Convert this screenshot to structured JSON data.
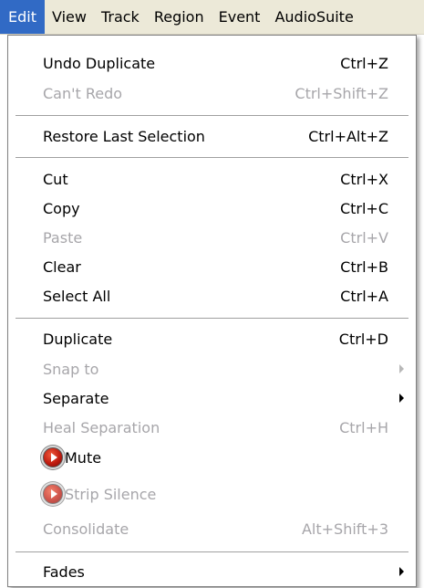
{
  "menubar": {
    "items": [
      {
        "label": "Edit"
      },
      {
        "label": "View"
      },
      {
        "label": "Track"
      },
      {
        "label": "Region"
      },
      {
        "label": "Event"
      },
      {
        "label": "AudioSuite"
      }
    ]
  },
  "menu": {
    "undo": {
      "label": "Undo Duplicate",
      "shortcut": "Ctrl+Z",
      "enabled": true
    },
    "redo": {
      "label": "Can't Redo",
      "shortcut": "Ctrl+Shift+Z",
      "enabled": false
    },
    "restore": {
      "label": "Restore Last Selection",
      "shortcut": "Ctrl+Alt+Z",
      "enabled": true
    },
    "cut": {
      "label": "Cut",
      "shortcut": "Ctrl+X",
      "enabled": true
    },
    "copy": {
      "label": "Copy",
      "shortcut": "Ctrl+C",
      "enabled": true
    },
    "paste": {
      "label": "Paste",
      "shortcut": "Ctrl+V",
      "enabled": false
    },
    "clear": {
      "label": "Clear",
      "shortcut": "Ctrl+B",
      "enabled": true
    },
    "select_all": {
      "label": "Select All",
      "shortcut": "Ctrl+A",
      "enabled": true
    },
    "duplicate": {
      "label": "Duplicate",
      "shortcut": "Ctrl+D",
      "enabled": true
    },
    "snap_to": {
      "label": "Snap to",
      "submenu": true,
      "enabled": false
    },
    "separate": {
      "label": "Separate",
      "submenu": true,
      "enabled": true
    },
    "heal": {
      "label": "Heal Separation",
      "shortcut": "Ctrl+H",
      "enabled": false
    },
    "mute": {
      "label": "Mute",
      "icon": "audiosuite-plugin-icon",
      "enabled": true
    },
    "strip_silence": {
      "label": "Strip Silence",
      "icon": "audiosuite-plugin-icon",
      "enabled": false
    },
    "consolidate": {
      "label": "Consolidate",
      "shortcut": "Alt+Shift+3",
      "enabled": false
    },
    "fades": {
      "label": "Fades",
      "submenu": true,
      "enabled": true
    }
  }
}
